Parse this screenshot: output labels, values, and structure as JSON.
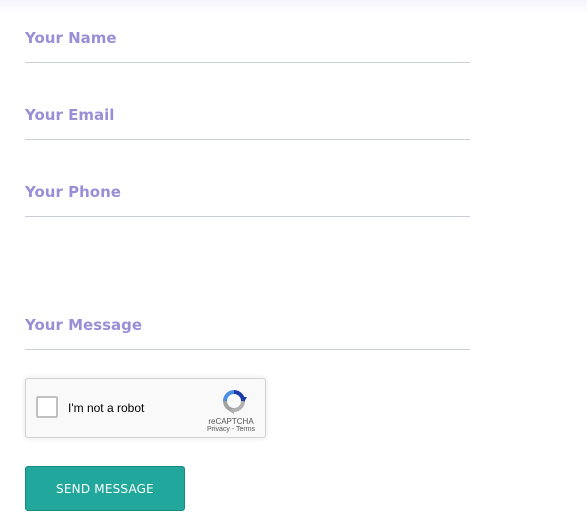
{
  "form": {
    "name": {
      "placeholder": "Your Name",
      "value": ""
    },
    "email": {
      "placeholder": "Your Email",
      "value": ""
    },
    "phone": {
      "placeholder": "Your Phone",
      "value": ""
    },
    "message": {
      "placeholder": "Your Message",
      "value": ""
    }
  },
  "recaptcha": {
    "label": "I'm not a robot",
    "brand": "reCAPTCHA",
    "privacy_link": "Privacy",
    "separator": " - ",
    "terms_link": "Terms",
    "checked": false
  },
  "submit": {
    "label": "SEND MESSAGE"
  },
  "colors": {
    "placeholder": "#9a8fd6",
    "underline": "#c9ced8",
    "button": "#21a79b",
    "button_text": "#ffffff"
  },
  "icons": {
    "recaptcha_logo": "recaptcha-logo-icon"
  }
}
